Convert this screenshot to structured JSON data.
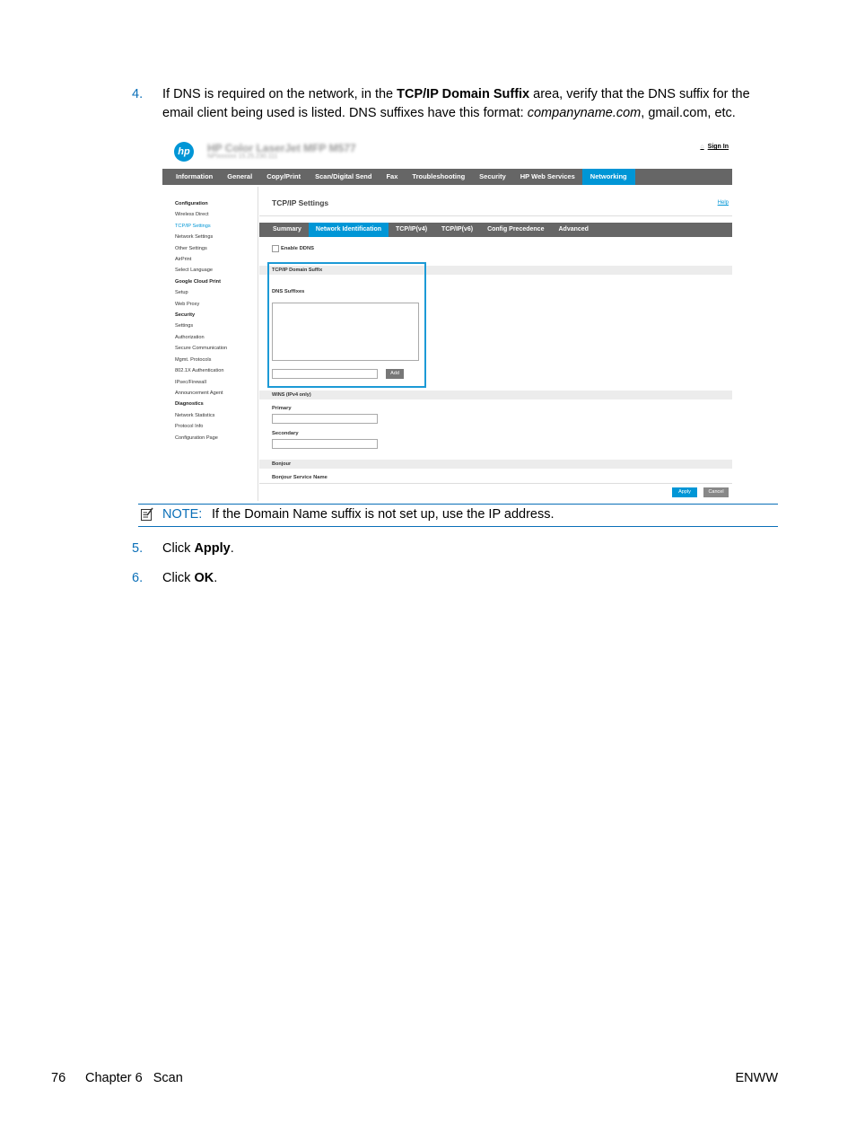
{
  "steps": [
    {
      "num": "4.",
      "pre": "If DNS is required on the network, in the ",
      "ui": "TCP/IP Domain Suffix",
      "mid": " area, verify that the DNS suffix for the email client being used is listed. DNS suffixes have this format: ",
      "em": "companyname.com",
      "post": ", gmail.com, etc."
    },
    {
      "num": "5.",
      "pre": "Click ",
      "ui": "Apply",
      "post": "."
    },
    {
      "num": "6.",
      "pre": "Click ",
      "ui": "OK",
      "post": "."
    }
  ],
  "screenshot": {
    "logo": "hp",
    "title_blurred": "HP Color LaserJet MFP M577",
    "subtitle_blurred": "NPIxxxxxx    15.25.230.111",
    "sign_in": "Sign In",
    "top_tabs": [
      "Information",
      "General",
      "Copy/Print",
      "Scan/Digital Send",
      "Fax",
      "Troubleshooting",
      "Security",
      "HP Web Services",
      "Networking"
    ],
    "active_top_tab": "Networking",
    "left_nav": [
      {
        "label": "Configuration",
        "style": "bold"
      },
      {
        "label": "Wireless Direct",
        "style": ""
      },
      {
        "label": "TCP/IP Settings",
        "style": "active"
      },
      {
        "label": "Network Settings",
        "style": ""
      },
      {
        "label": "Other Settings",
        "style": ""
      },
      {
        "label": "AirPrint",
        "style": ""
      },
      {
        "label": "Select Language",
        "style": ""
      },
      {
        "label": "Google Cloud Print",
        "style": "bold"
      },
      {
        "label": "Setup",
        "style": ""
      },
      {
        "label": "Web Proxy",
        "style": ""
      },
      {
        "label": "Security",
        "style": "bold"
      },
      {
        "label": "Settings",
        "style": ""
      },
      {
        "label": "Authorization",
        "style": ""
      },
      {
        "label": "Secure Communication",
        "style": ""
      },
      {
        "label": "Mgmt. Protocols",
        "style": ""
      },
      {
        "label": "802.1X Authentication",
        "style": ""
      },
      {
        "label": "IPsec/Firewall",
        "style": ""
      },
      {
        "label": "Announcement Agent",
        "style": ""
      },
      {
        "label": "Diagnostics",
        "style": "bold"
      },
      {
        "label": "Network Statistics",
        "style": ""
      },
      {
        "label": "Protocol Info",
        "style": ""
      },
      {
        "label": "Configuration Page",
        "style": ""
      }
    ],
    "page_title": "TCP/IP Settings",
    "help": "Help",
    "sub_tabs": [
      "Summary",
      "Network Identification",
      "TCP/IP(v4)",
      "TCP/IP(v6)",
      "Config Precedence",
      "Advanced"
    ],
    "active_sub_tab": "Network Identification",
    "enable_ddns": "Enable DDNS",
    "domain_suffix_section": "TCP/IP Domain Suffix",
    "dns_suffixes_label": "DNS Suffixes",
    "add_button": "Add",
    "wins_section": "WINS (IPv4 only)",
    "primary_label": "Primary",
    "secondary_label": "Secondary",
    "bonjour_section": "Bonjour",
    "bonjour_service_name": "Bonjour Service Name",
    "apply_button": "Apply",
    "cancel_button": "Cancel"
  },
  "note": {
    "label": "NOTE:",
    "text": "If the Domain Name suffix is not set up, use the IP address."
  },
  "footer": {
    "page": "76",
    "chapter": "Chapter 6   Scan",
    "right": "ENWW"
  },
  "colors": {
    "accent": "#0a6fb8",
    "hp_blue": "#0096d6",
    "nav_gray": "#666666"
  }
}
